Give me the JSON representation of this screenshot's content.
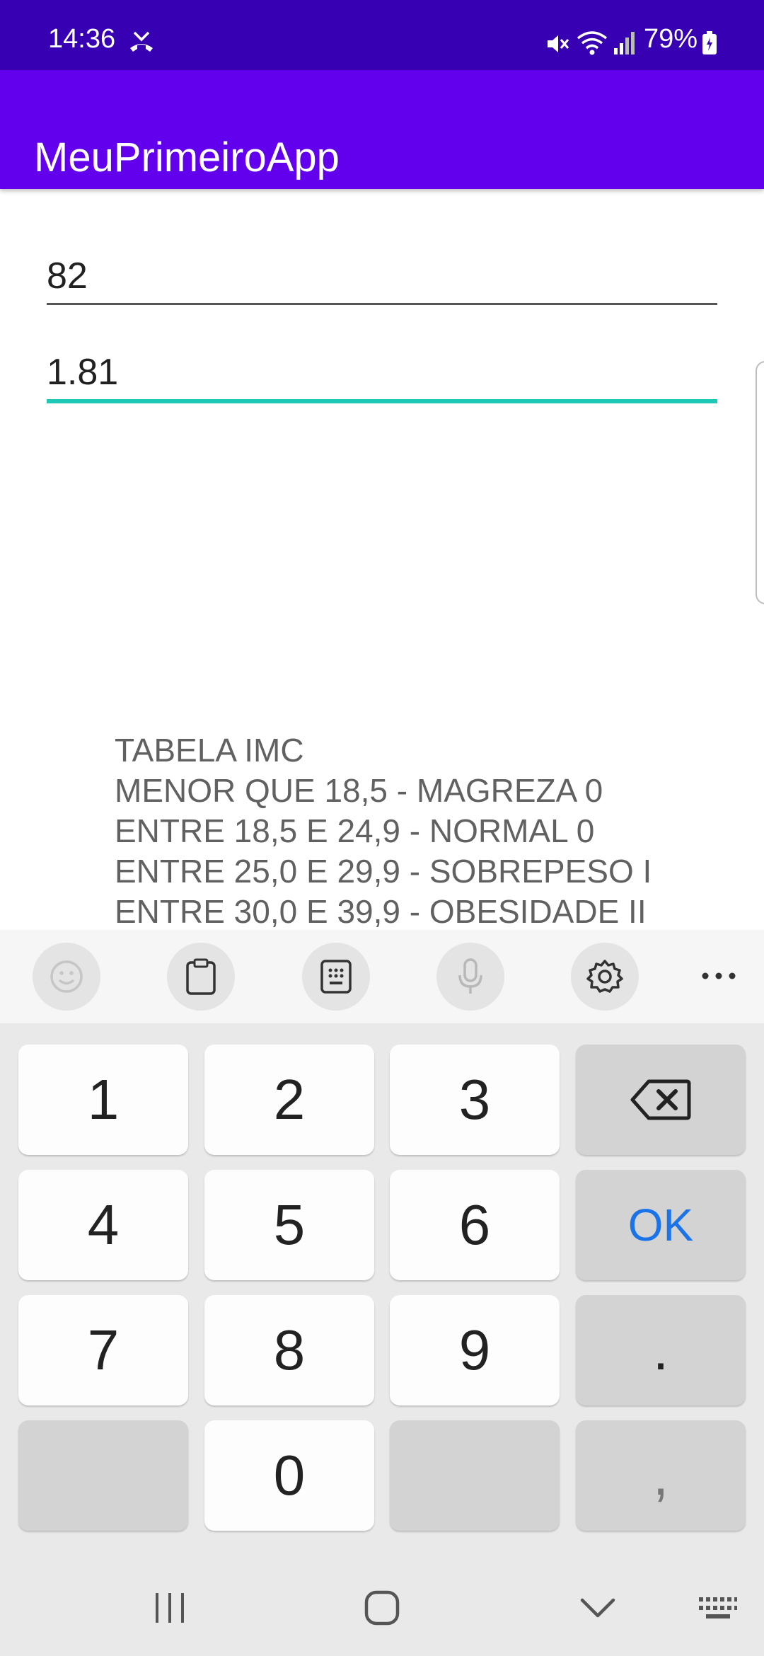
{
  "status_bar": {
    "time": "14:36",
    "battery": "79%",
    "icons": [
      "missed-call-icon",
      "mute-icon",
      "wifi-icon",
      "signal-icon",
      "battery-icon"
    ]
  },
  "app_bar": {
    "title": "MeuPrimeiroApp",
    "color": "#6200ee"
  },
  "form": {
    "weight_value": "82",
    "height_value": "1.81",
    "focus_color": "#1fc7b6"
  },
  "imc_table": {
    "title": "TABELA IMC",
    "rows": [
      "MENOR QUE 18,5 - MAGREZA 0",
      "ENTRE 18,5 E 24,9 - NORMAL 0",
      "ENTRE 25,0 E 29,9 - SOBREPESO I",
      "ENTRE 30,0 E 39,9 - OBESIDADE II"
    ]
  },
  "keyboard": {
    "toolbar_icons": [
      "emoji-icon",
      "clipboard-icon",
      "keypad-icon",
      "mic-icon",
      "settings-icon",
      "more-icon"
    ],
    "keys": {
      "k1": "1",
      "k2": "2",
      "k3": "3",
      "k4": "4",
      "k5": "5",
      "k6": "6",
      "k7": "7",
      "k8": "8",
      "k9": "9",
      "k0": "0",
      "ok": "OK",
      "dot": ".",
      "comma": ","
    },
    "accent_color": "#1a73e8"
  },
  "nav_bar": {
    "icons": [
      "recents-icon",
      "home-icon",
      "back-icon",
      "keyboard-switch-icon"
    ]
  }
}
